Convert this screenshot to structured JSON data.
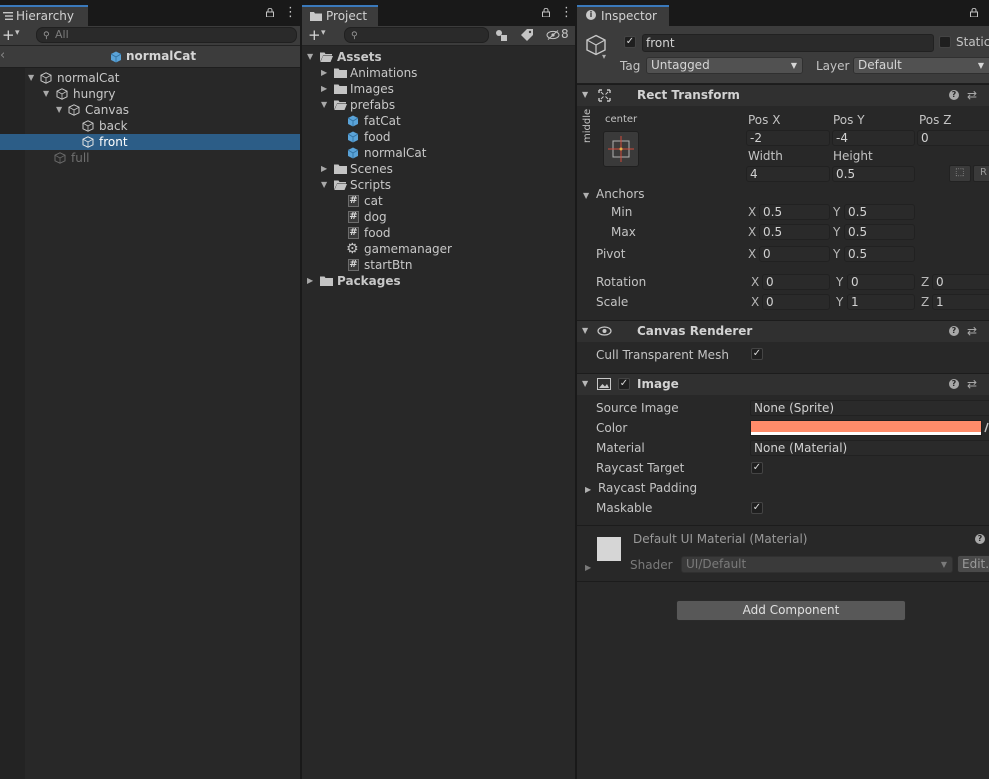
{
  "hierarchy": {
    "tab_label": "Hierarchy",
    "search_placeholder": "All",
    "scene_title": "normalCat",
    "nodes": [
      {
        "label": "normalCat"
      },
      {
        "label": "hungry"
      },
      {
        "label": "Canvas"
      },
      {
        "label": "back"
      },
      {
        "label": "front"
      },
      {
        "label": "full"
      }
    ]
  },
  "project": {
    "tab_label": "Project",
    "hidden_count": "8",
    "items": [
      {
        "label": "Assets"
      },
      {
        "label": "Animations"
      },
      {
        "label": "Images"
      },
      {
        "label": "prefabs"
      },
      {
        "label": "fatCat"
      },
      {
        "label": "food"
      },
      {
        "label": "normalCat"
      },
      {
        "label": "Scenes"
      },
      {
        "label": "Scripts"
      },
      {
        "label": "cat"
      },
      {
        "label": "dog"
      },
      {
        "label": "food"
      },
      {
        "label": "gamemanager"
      },
      {
        "label": "startBtn"
      },
      {
        "label": "Packages"
      }
    ]
  },
  "inspector": {
    "tab_label": "Inspector",
    "object_name": "front",
    "static_label": "Static",
    "tag_label": "Tag",
    "tag_value": "Untagged",
    "layer_label": "Layer",
    "layer_value": "Default",
    "rect_transform": {
      "title": "Rect Transform",
      "anchor_h": "center",
      "anchor_v": "middle",
      "pos_x_label": "Pos X",
      "pos_x": "-2",
      "pos_y_label": "Pos Y",
      "pos_y": "-4",
      "pos_z_label": "Pos Z",
      "pos_z": "0",
      "width_label": "Width",
      "width": "4",
      "height_label": "Height",
      "height": "0.5",
      "anchors_label": "Anchors",
      "min_label": "Min",
      "min_x": "0.5",
      "min_y": "0.5",
      "max_label": "Max",
      "max_x": "0.5",
      "max_y": "0.5",
      "pivot_label": "Pivot",
      "pivot_x": "0",
      "pivot_y": "0.5",
      "rotation_label": "Rotation",
      "rot_x": "0",
      "rot_y": "0",
      "rot_z": "0",
      "scale_label": "Scale",
      "scale_x": "0",
      "scale_y": "1",
      "scale_z": "1",
      "axis_x": "X",
      "axis_y": "Y",
      "axis_z": "Z"
    },
    "canvas_renderer": {
      "title": "Canvas Renderer",
      "cull_label": "Cull Transparent Mesh"
    },
    "image": {
      "title": "Image",
      "source_image_label": "Source Image",
      "source_image": "None (Sprite)",
      "color_label": "Color",
      "color": "#ff8c6a",
      "material_label": "Material",
      "material": "None (Material)",
      "raycast_target_label": "Raycast Target",
      "raycast_padding_label": "Raycast Padding",
      "maskable_label": "Maskable"
    },
    "material_block": {
      "title": "Default UI Material (Material)",
      "shader_label": "Shader",
      "shader_value": "UI/Default",
      "edit_label": "Edit..."
    },
    "add_component_label": "Add Component"
  }
}
